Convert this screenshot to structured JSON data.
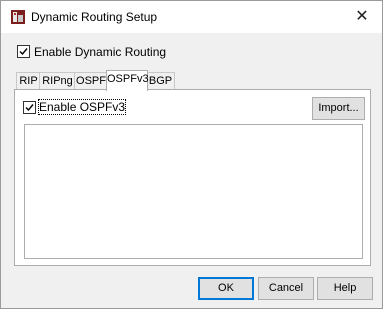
{
  "window": {
    "title": "Dynamic Routing Setup",
    "close_glyph": "✕",
    "icon": "app-routing-icon"
  },
  "enable_dynamic_routing": {
    "label": "Enable Dynamic Routing",
    "checked": true
  },
  "tabs": [
    {
      "label": "RIP",
      "active": false
    },
    {
      "label": "RIPng",
      "active": false
    },
    {
      "label": "OSPF",
      "active": false
    },
    {
      "label": "OSPFv3",
      "active": true
    },
    {
      "label": "BGP",
      "active": false
    }
  ],
  "ospfv3_panel": {
    "enable_label": "Enable OSPFv3",
    "enable_checked": true,
    "import_label": "Import..."
  },
  "footer": {
    "ok_label": "OK",
    "cancel_label": "Cancel",
    "help_label": "Help"
  },
  "colors": {
    "accent": "#0078d7",
    "dialog_bg": "#f0f0f0"
  }
}
